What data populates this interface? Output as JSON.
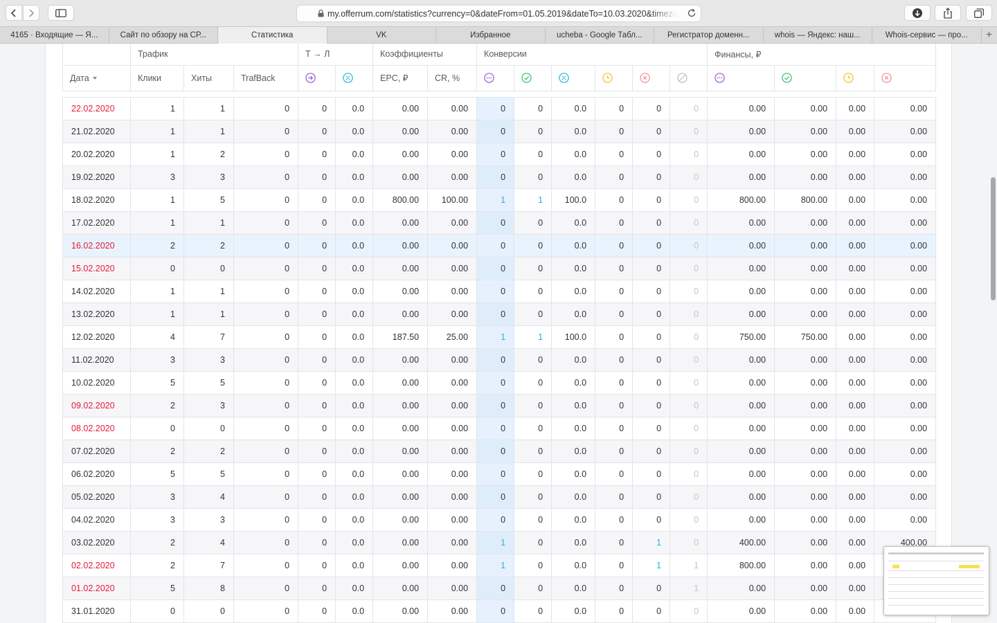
{
  "browser": {
    "url": "my.offerrum.com/statistics?currency=0&dateFrom=01.05.2019&dateTo=10.03.2020&timezone=3",
    "tabs": [
      {
        "label": "4165 · Входящие — Я..."
      },
      {
        "label": "Сайт по обзору на СР..."
      },
      {
        "label": "Статистика",
        "active": true
      },
      {
        "label": "VK"
      },
      {
        "label": "Избранное"
      },
      {
        "label": "ucheba - Google Табл..."
      },
      {
        "label": "Регистратор доменн..."
      },
      {
        "label": "whois — Яндекс: наш..."
      },
      {
        "label": "Whois-сервис — про..."
      }
    ]
  },
  "table": {
    "groups": {
      "traffic": "Трафик",
      "tl": "Т → Л",
      "coef": "Коэффициенты",
      "conversions": "Конверсии",
      "finance": "Финансы, ₽"
    },
    "headers": {
      "date": "Дата",
      "clicks": "Клики",
      "hits": "Хиты",
      "trafback": "TrafBack",
      "epc": "EPC, ₽",
      "cr": "CR, %"
    },
    "icon_colors": {
      "purple": "#9b59d0",
      "teal": "#27b3d6",
      "green": "#2fc26b",
      "yellow": "#f2c41b",
      "red": "#f08e9b",
      "grey": "#bdbdbd"
    },
    "rows": [
      {
        "date": "22.02.2020",
        "weekend": true,
        "v": [
          "1",
          "1",
          "0",
          "0",
          "0.0",
          "0.00",
          "0.00",
          "0",
          "0",
          "0.0",
          "0",
          "0",
          "0",
          "0.00",
          "0.00",
          "0.00",
          "0.00"
        ]
      },
      {
        "date": "21.02.2020",
        "weekend": false,
        "v": [
          "1",
          "1",
          "0",
          "0",
          "0.0",
          "0.00",
          "0.00",
          "0",
          "0",
          "0.0",
          "0",
          "0",
          "0",
          "0.00",
          "0.00",
          "0.00",
          "0.00"
        ]
      },
      {
        "date": "20.02.2020",
        "weekend": false,
        "v": [
          "1",
          "2",
          "0",
          "0",
          "0.0",
          "0.00",
          "0.00",
          "0",
          "0",
          "0.0",
          "0",
          "0",
          "0",
          "0.00",
          "0.00",
          "0.00",
          "0.00"
        ]
      },
      {
        "date": "19.02.2020",
        "weekend": false,
        "v": [
          "3",
          "3",
          "0",
          "0",
          "0.0",
          "0.00",
          "0.00",
          "0",
          "0",
          "0.0",
          "0",
          "0",
          "0",
          "0.00",
          "0.00",
          "0.00",
          "0.00"
        ]
      },
      {
        "date": "18.02.2020",
        "weekend": false,
        "v": [
          "1",
          "5",
          "0",
          "0",
          "0.0",
          "800.00",
          "100.00",
          "1",
          "1",
          "100.0",
          "0",
          "0",
          "0",
          "800.00",
          "800.00",
          "0.00",
          "0.00"
        ]
      },
      {
        "date": "17.02.2020",
        "weekend": false,
        "v": [
          "1",
          "1",
          "0",
          "0",
          "0.0",
          "0.00",
          "0.00",
          "0",
          "0",
          "0.0",
          "0",
          "0",
          "0",
          "0.00",
          "0.00",
          "0.00",
          "0.00"
        ]
      },
      {
        "date": "16.02.2020",
        "weekend": true,
        "highlight": true,
        "v": [
          "2",
          "2",
          "0",
          "0",
          "0.0",
          "0.00",
          "0.00",
          "0",
          "0",
          "0.0",
          "0",
          "0",
          "0",
          "0.00",
          "0.00",
          "0.00",
          "0.00"
        ]
      },
      {
        "date": "15.02.2020",
        "weekend": true,
        "v": [
          "0",
          "0",
          "0",
          "0",
          "0.0",
          "0.00",
          "0.00",
          "0",
          "0",
          "0.0",
          "0",
          "0",
          "0",
          "0.00",
          "0.00",
          "0.00",
          "0.00"
        ]
      },
      {
        "date": "14.02.2020",
        "weekend": false,
        "v": [
          "1",
          "1",
          "0",
          "0",
          "0.0",
          "0.00",
          "0.00",
          "0",
          "0",
          "0.0",
          "0",
          "0",
          "0",
          "0.00",
          "0.00",
          "0.00",
          "0.00"
        ]
      },
      {
        "date": "13.02.2020",
        "weekend": false,
        "v": [
          "1",
          "1",
          "0",
          "0",
          "0.0",
          "0.00",
          "0.00",
          "0",
          "0",
          "0.0",
          "0",
          "0",
          "0",
          "0.00",
          "0.00",
          "0.00",
          "0.00"
        ]
      },
      {
        "date": "12.02.2020",
        "weekend": false,
        "v": [
          "4",
          "7",
          "0",
          "0",
          "0.0",
          "187.50",
          "25.00",
          "1",
          "1",
          "100.0",
          "0",
          "0",
          "0",
          "750.00",
          "750.00",
          "0.00",
          "0.00"
        ]
      },
      {
        "date": "11.02.2020",
        "weekend": false,
        "v": [
          "3",
          "3",
          "0",
          "0",
          "0.0",
          "0.00",
          "0.00",
          "0",
          "0",
          "0.0",
          "0",
          "0",
          "0",
          "0.00",
          "0.00",
          "0.00",
          "0.00"
        ]
      },
      {
        "date": "10.02.2020",
        "weekend": false,
        "v": [
          "5",
          "5",
          "0",
          "0",
          "0.0",
          "0.00",
          "0.00",
          "0",
          "0",
          "0.0",
          "0",
          "0",
          "0",
          "0.00",
          "0.00",
          "0.00",
          "0.00"
        ]
      },
      {
        "date": "09.02.2020",
        "weekend": true,
        "v": [
          "2",
          "3",
          "0",
          "0",
          "0.0",
          "0.00",
          "0.00",
          "0",
          "0",
          "0.0",
          "0",
          "0",
          "0",
          "0.00",
          "0.00",
          "0.00",
          "0.00"
        ]
      },
      {
        "date": "08.02.2020",
        "weekend": true,
        "v": [
          "0",
          "0",
          "0",
          "0",
          "0.0",
          "0.00",
          "0.00",
          "0",
          "0",
          "0.0",
          "0",
          "0",
          "0",
          "0.00",
          "0.00",
          "0.00",
          "0.00"
        ]
      },
      {
        "date": "07.02.2020",
        "weekend": false,
        "v": [
          "2",
          "2",
          "0",
          "0",
          "0.0",
          "0.00",
          "0.00",
          "0",
          "0",
          "0.0",
          "0",
          "0",
          "0",
          "0.00",
          "0.00",
          "0.00",
          "0.00"
        ]
      },
      {
        "date": "06.02.2020",
        "weekend": false,
        "v": [
          "5",
          "5",
          "0",
          "0",
          "0.0",
          "0.00",
          "0.00",
          "0",
          "0",
          "0.0",
          "0",
          "0",
          "0",
          "0.00",
          "0.00",
          "0.00",
          "0.00"
        ]
      },
      {
        "date": "05.02.2020",
        "weekend": false,
        "v": [
          "3",
          "4",
          "0",
          "0",
          "0.0",
          "0.00",
          "0.00",
          "0",
          "0",
          "0.0",
          "0",
          "0",
          "0",
          "0.00",
          "0.00",
          "0.00",
          "0.00"
        ]
      },
      {
        "date": "04.02.2020",
        "weekend": false,
        "v": [
          "3",
          "3",
          "0",
          "0",
          "0.0",
          "0.00",
          "0.00",
          "0",
          "0",
          "0.0",
          "0",
          "0",
          "0",
          "0.00",
          "0.00",
          "0.00",
          "0.00"
        ]
      },
      {
        "date": "03.02.2020",
        "weekend": false,
        "v": [
          "2",
          "4",
          "0",
          "0",
          "0.0",
          "0.00",
          "0.00",
          "1",
          "0",
          "0.0",
          "0",
          "1",
          "0",
          "400.00",
          "0.00",
          "0.00",
          "400.00"
        ]
      },
      {
        "date": "02.02.2020",
        "weekend": true,
        "v": [
          "2",
          "7",
          "0",
          "0",
          "0.0",
          "0.00",
          "0.00",
          "1",
          "0",
          "0.0",
          "0",
          "1",
          "1",
          "800.00",
          "0.00",
          "0.00",
          "0.00"
        ]
      },
      {
        "date": "01.02.2020",
        "weekend": true,
        "v": [
          "5",
          "8",
          "0",
          "0",
          "0.0",
          "0.00",
          "0.00",
          "0",
          "0",
          "0.0",
          "0",
          "0",
          "1",
          "0.00",
          "0.00",
          "0.00",
          "0.00"
        ]
      },
      {
        "date": "31.01.2020",
        "weekend": false,
        "v": [
          "0",
          "0",
          "0",
          "0",
          "0.0",
          "0.00",
          "0.00",
          "0",
          "0",
          "0.0",
          "0",
          "0",
          "0",
          "0.00",
          "0.00",
          "0.00",
          "0.00"
        ]
      }
    ]
  }
}
